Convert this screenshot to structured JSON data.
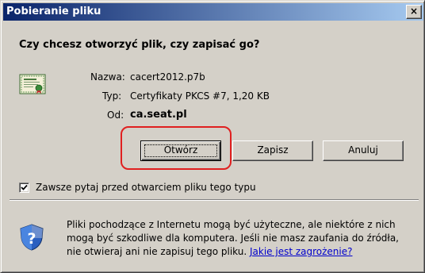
{
  "window": {
    "title": "Pobieranie pliku",
    "close_label": "×"
  },
  "dialog": {
    "question": "Czy chcesz otworzyć plik, czy zapisać go?",
    "file": {
      "icon": "certificate-file-icon",
      "name_label": "Nazwa:",
      "name_value": "cacert2012.p7b",
      "type_label": "Typ:",
      "type_value": "Certyfikaty PKCS #7, 1,20 KB",
      "from_label": "Od:",
      "from_value": "ca.seat.pl"
    },
    "buttons": {
      "open": "Otwórz",
      "save": "Zapisz",
      "cancel": "Anuluj"
    },
    "always_ask": {
      "label": "Zawsze pytaj przed otwarciem pliku tego typu",
      "checked": true
    },
    "warning": {
      "icon": "security-shield-icon",
      "line1": "Pliki pochodzące z Internetu mogą być użyteczne, ale niektóre z nich",
      "line2": "mogą być szkodliwe dla komputera. Jeśli nie masz zaufania do źródła,",
      "line3_text": "nie otwieraj ani nie zapisuj tego pliku.",
      "line3_link": "Jakie jest zagrożenie?"
    }
  },
  "annotation": {
    "highlight_color": "#e02020"
  },
  "colors": {
    "title_bar_start": "#0a246a",
    "title_bar_end": "#a6caf0",
    "dialog_bg": "#d4d0c8",
    "link": "#0000cc"
  }
}
